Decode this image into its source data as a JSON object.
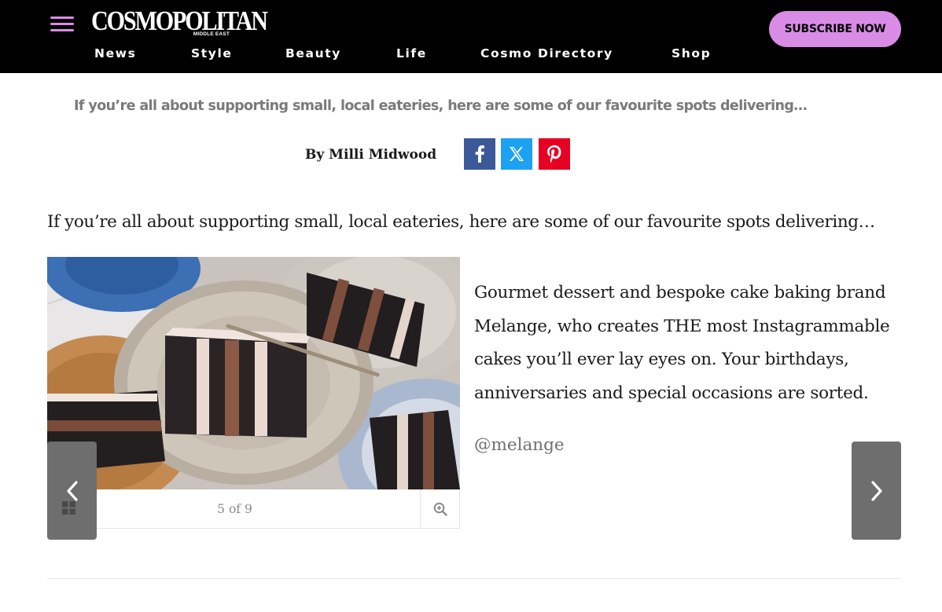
{
  "header": {
    "logo": {
      "main": "COSMOPOLITAN",
      "sub": "MIDDLE EAST"
    },
    "nav": [
      "News",
      "Style",
      "Beauty",
      "Life",
      "Cosmo Directory",
      "Shop"
    ],
    "subscribe_label": "SUBSCRIBE NOW",
    "accent_color": "#d98ce6"
  },
  "article": {
    "standfirst": "If you’re all about supporting small, local eateries, here are some of our favourite spots delivering…",
    "byline_prefix": "By",
    "author": "Milli Midwood",
    "share": [
      {
        "network": "facebook",
        "icon": "facebook-icon",
        "color": "#3b5998"
      },
      {
        "network": "x",
        "icon": "x-icon",
        "color": "#1da1f2"
      },
      {
        "network": "pinterest",
        "icon": "pinterest-icon",
        "color": "#e60023"
      }
    ],
    "intro": "If you’re all about supporting small, local eateries, here are some of our favourite spots delivering…"
  },
  "slideshow": {
    "image_alt": "Slices of dark chocolate layer cake on plates",
    "counter": "5 of 9",
    "current": 5,
    "total": 9,
    "caption": "Gourmet dessert and bespoke cake baking brand Melange, who creates THE most Instagrammable cakes you’ll ever lay eyes on. Your birthdays, anniversaries and special occasions are sorted.",
    "credit": "@melange",
    "icons": {
      "prev": "chevron-left-icon",
      "next": "chevron-right-icon",
      "grid": "grid-icon",
      "zoom": "zoom-in-icon"
    }
  }
}
